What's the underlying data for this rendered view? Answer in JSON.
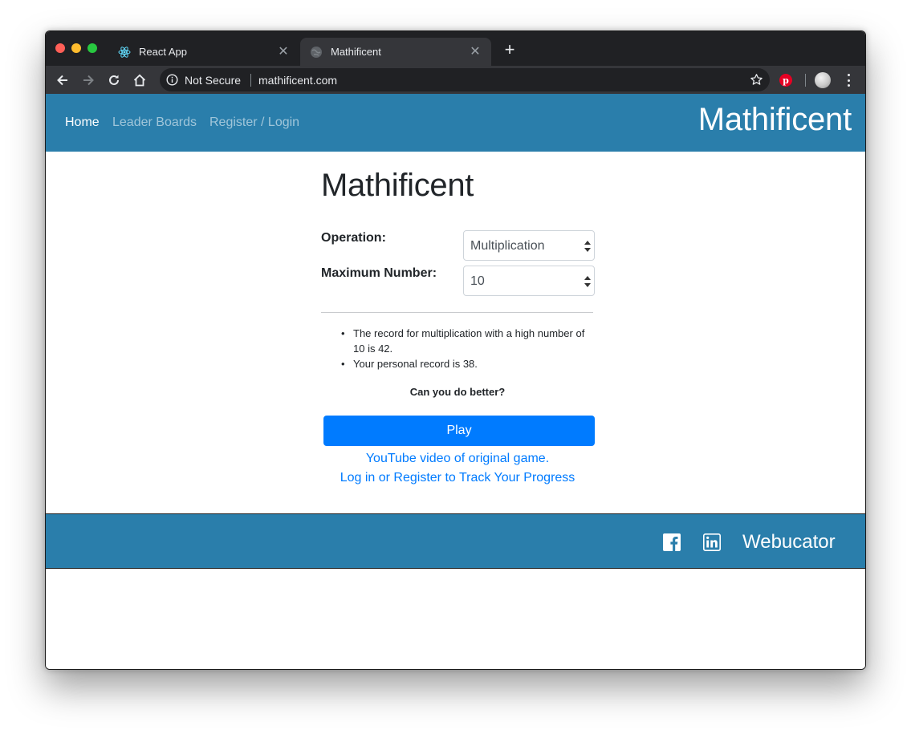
{
  "browser": {
    "tabs": [
      {
        "title": "React App",
        "favicon": "react-icon"
      },
      {
        "title": "Mathificent",
        "favicon": "globe-icon"
      }
    ],
    "new_tab_symbol": "+",
    "security_label": "Not Secure",
    "url": "mathificent.com",
    "extension_icon": "pinterest-icon"
  },
  "navbar": {
    "links": [
      "Home",
      "Leader Boards",
      "Register / Login"
    ],
    "active_link": "Home",
    "brand": "Mathificent"
  },
  "main": {
    "title": "Mathificent",
    "operation_label": "Operation:",
    "operation_value": "Multiplication",
    "max_number_label": "Maximum Number:",
    "max_number_value": "10",
    "records": [
      "The record for multiplication with a high number of 10 is 42.",
      "Your personal record is 38."
    ],
    "challenge": "Can you do better?",
    "play_label": "Play",
    "video_link": "YouTube video of original game.",
    "login_link": "Log in or Register to Track Your Progress"
  },
  "footer": {
    "icons": [
      "facebook-icon",
      "linkedin-icon"
    ],
    "brand": "Webucator"
  },
  "colors": {
    "nav_bg": "#2a7eab",
    "primary": "#007bff",
    "chrome_dark": "#202124",
    "chrome_toolbar": "#35363a"
  }
}
